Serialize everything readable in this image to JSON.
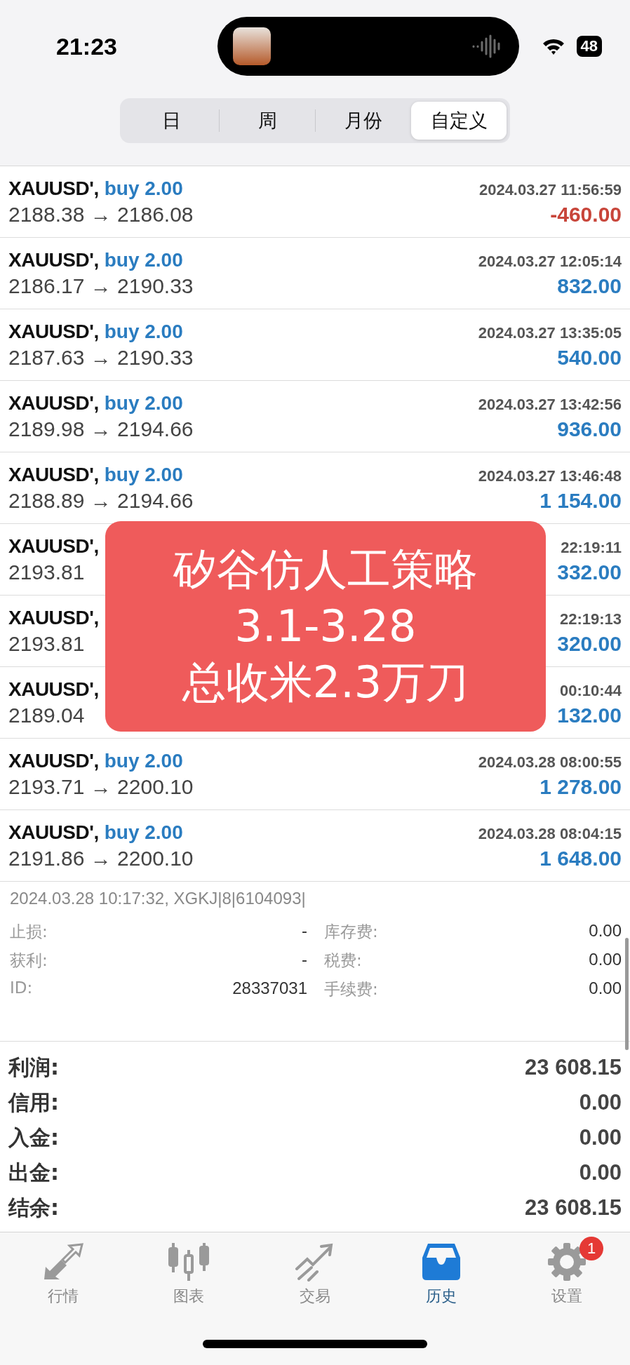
{
  "status_bar": {
    "time": "21:23",
    "battery": "48"
  },
  "period_tabs": [
    {
      "label": "日",
      "selected": false
    },
    {
      "label": "周",
      "selected": false
    },
    {
      "label": "月份",
      "selected": false
    },
    {
      "label": "自定义",
      "selected": true
    }
  ],
  "trades": [
    {
      "symbol": "XAUUSD',",
      "order": "buy 2.00",
      "time": "2024.03.27 11:56:59",
      "prices": "2188.38 → 2186.08",
      "profit": "-460.00",
      "loss": true
    },
    {
      "symbol": "XAUUSD',",
      "order": "buy 2.00",
      "time": "2024.03.27 12:05:14",
      "prices": "2186.17 → 2190.33",
      "profit": "832.00",
      "loss": false
    },
    {
      "symbol": "XAUUSD',",
      "order": "buy 2.00",
      "time": "2024.03.27 13:35:05",
      "prices": "2187.63 → 2190.33",
      "profit": "540.00",
      "loss": false
    },
    {
      "symbol": "XAUUSD',",
      "order": "buy 2.00",
      "time": "2024.03.27 13:42:56",
      "prices": "2189.98 → 2194.66",
      "profit": "936.00",
      "loss": false
    },
    {
      "symbol": "XAUUSD',",
      "order": "buy 2.00",
      "time": "2024.03.27 13:46:48",
      "prices": "2188.89 → 2194.66",
      "profit": "1 154.00",
      "loss": false
    },
    {
      "symbol": "XAUUSD',",
      "time": "22:19:11",
      "prices": "2193.81",
      "profit": "332.00",
      "loss": false
    },
    {
      "symbol": "XAUUSD',",
      "time": "22:19:13",
      "prices": "2193.81",
      "profit": "320.00",
      "loss": false
    },
    {
      "symbol": "XAUUSD',",
      "time": "00:10:44",
      "prices": "2189.04",
      "profit": "132.00",
      "loss": false
    },
    {
      "symbol": "XAUUSD',",
      "order": "buy 2.00",
      "time": "2024.03.28 08:00:55",
      "prices": "2193.71 → 2200.10",
      "profit": "1 278.00",
      "loss": false
    },
    {
      "symbol": "XAUUSD',",
      "order": "buy 2.00",
      "time": "2024.03.28 08:04:15",
      "prices": "2191.86 → 2200.10",
      "profit": "1 648.00",
      "loss": false
    }
  ],
  "order_detail": {
    "comment": "2024.03.28 10:17:32, XGKJ|8|6104093|",
    "fields": [
      {
        "label": "止损:",
        "value": "-"
      },
      {
        "label": "库存费:",
        "value": "0.00"
      },
      {
        "label": "获利:",
        "value": "-"
      },
      {
        "label": "税费:",
        "value": "0.00"
      },
      {
        "label": "ID:",
        "value": "28337031"
      },
      {
        "label": "手续费:",
        "value": "0.00"
      }
    ]
  },
  "summary": [
    {
      "label": "利润:",
      "value": "23 608.15"
    },
    {
      "label": "信用:",
      "value": "0.00"
    },
    {
      "label": "入金:",
      "value": "0.00"
    },
    {
      "label": "出金:",
      "value": "0.00"
    },
    {
      "label": "结余:",
      "value": "23 608.15"
    }
  ],
  "overlay_banner": {
    "lines": [
      "矽谷仿人工策略",
      "3.1-3.28",
      "总收米2.3万刀"
    ]
  },
  "tab_bar": [
    {
      "label": "行情",
      "kind": "quotes",
      "selected": false
    },
    {
      "label": "图表",
      "kind": "chart",
      "selected": false
    },
    {
      "label": "交易",
      "kind": "trade",
      "selected": false
    },
    {
      "label": "历史",
      "kind": "history",
      "selected": true
    },
    {
      "label": "设置",
      "kind": "settings",
      "selected": false,
      "badge": "1"
    }
  ]
}
